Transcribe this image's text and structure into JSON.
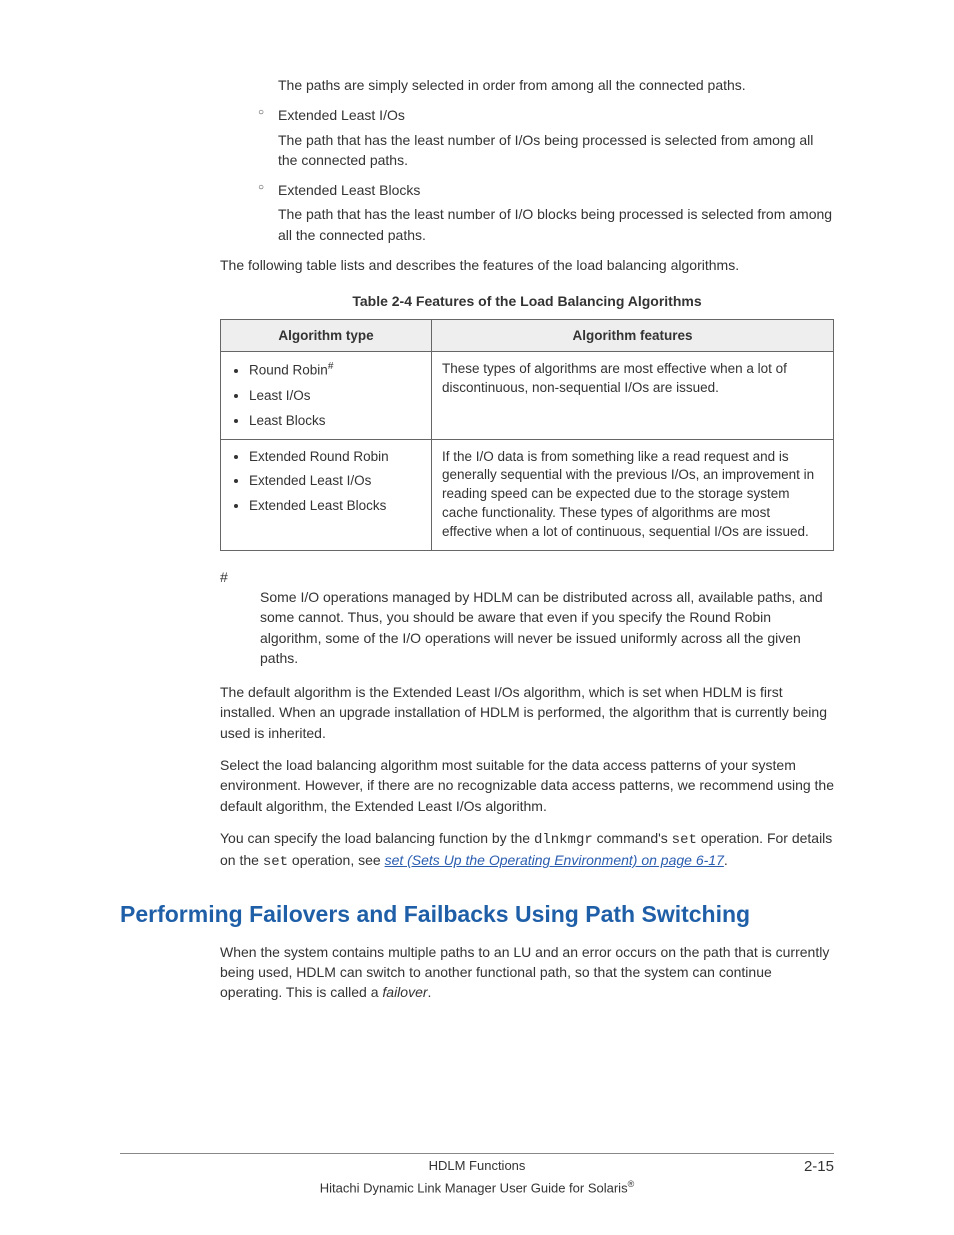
{
  "intro": {
    "sub1": "The paths are simply selected in order from among all the connected paths.",
    "b2_title": "Extended Least I/Os",
    "b2_body": "The path that has the least number of I/Os being processed is selected from among all the connected paths.",
    "b3_title": "Extended Least Blocks",
    "b3_body": "The path that has the least number of I/O blocks being processed is selected from among all the connected paths.",
    "lead": "The following table lists and describes the features of the load balancing algorithms."
  },
  "table": {
    "caption": "Table 2-4 Features of the Load Balancing Algorithms",
    "h1": "Algorithm type",
    "h2": "Algorithm features",
    "r1a1": "Round Robin",
    "r1a2": "Least I/Os",
    "r1a3": "Least Blocks",
    "r1f": "These types of algorithms are most effective when a lot of discontinuous, non-sequential I/Os are issued.",
    "r2a1": "Extended Round Robin",
    "r2a2": "Extended Least I/Os",
    "r2a3": "Extended Least Blocks",
    "r2f": "If the I/O data is from something like a read request and is generally sequential with the previous I/Os, an improvement in reading speed can be expected due to the storage system cache functionality. These types of algorithms are most effective when a lot of continuous, sequential I/Os are issued."
  },
  "hash": {
    "mark": "#",
    "body": "Some I/O operations managed by HDLM can be distributed across all, available paths, and some cannot. Thus, you should be aware that even if you specify the Round Robin algorithm, some of the I/O operations will never be issued uniformly across all the given paths."
  },
  "p_default": "The default algorithm is the Extended Least I/Os algorithm, which is set when HDLM is first installed. When an upgrade installation of HDLM is performed, the algorithm that is currently being used is inherited.",
  "p_select": "Select the load balancing algorithm most suitable for the data access patterns of your system environment. However, if there are no recognizable data access patterns, we recommend using the default algorithm, the Extended Least I/Os algorithm.",
  "p_cmd_pre": "You can specify the load balancing function by the ",
  "p_cmd_mono1": "dlnkmgr",
  "p_cmd_mid1": " command's ",
  "p_cmd_mono2": "set",
  "p_cmd_mid2": " operation. For details on the ",
  "p_cmd_mono3": "set",
  "p_cmd_mid3": " operation, see ",
  "p_cmd_link": "set (Sets Up the Operating Environment) on page 6-17",
  "p_cmd_end": ".",
  "section_heading": "Performing Failovers and Failbacks Using Path Switching",
  "section_p_pre": "When the system contains multiple paths to an LU and an error occurs on the path that is currently being used, HDLM can switch to another functional path, so that the system can continue operating. This is called a ",
  "section_p_em": "failover",
  "section_p_post": ".",
  "footer": {
    "title": "HDLM Functions",
    "page": "2-15",
    "doc": "Hitachi Dynamic Link Manager User Guide for Solaris"
  }
}
